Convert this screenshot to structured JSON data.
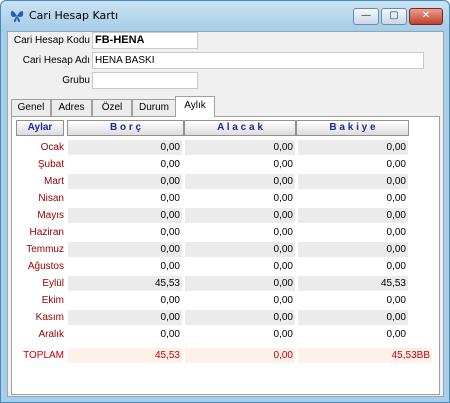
{
  "window": {
    "title": "Cari Hesap Kartı",
    "min_glyph": "—",
    "max_glyph": "▢",
    "close_glyph": "✕"
  },
  "form": {
    "code_label": "Cari Hesap Kodu",
    "code_value": "FB-HENA",
    "name_label": "Cari Hesap Adı",
    "name_value": "HENA BASKI",
    "group_label": "Grubu",
    "group_value": ""
  },
  "tabs": [
    "Genel",
    "Adres",
    "Özel",
    "Durum",
    "Aylık"
  ],
  "table": {
    "headers": [
      "Aylar",
      "B o r ç",
      "A l a c a k",
      "B a k i y e"
    ],
    "rows": [
      {
        "month": "Ocak",
        "borc": "0,00",
        "alacak": "0,00",
        "bakiye": "0,00"
      },
      {
        "month": "Şubat",
        "borc": "0,00",
        "alacak": "0,00",
        "bakiye": "0,00"
      },
      {
        "month": "Mart",
        "borc": "0,00",
        "alacak": "0,00",
        "bakiye": "0,00"
      },
      {
        "month": "Nisan",
        "borc": "0,00",
        "alacak": "0,00",
        "bakiye": "0,00"
      },
      {
        "month": "Mayıs",
        "borc": "0,00",
        "alacak": "0,00",
        "bakiye": "0,00"
      },
      {
        "month": "Haziran",
        "borc": "0,00",
        "alacak": "0,00",
        "bakiye": "0,00"
      },
      {
        "month": "Temmuz",
        "borc": "0,00",
        "alacak": "0,00",
        "bakiye": "0,00"
      },
      {
        "month": "Ağustos",
        "borc": "0,00",
        "alacak": "0,00",
        "bakiye": "0,00"
      },
      {
        "month": "Eylül",
        "borc": "45,53",
        "alacak": "0,00",
        "bakiye": "45,53"
      },
      {
        "month": "Ekim",
        "borc": "0,00",
        "alacak": "0,00",
        "bakiye": "0,00"
      },
      {
        "month": "Kasım",
        "borc": "0,00",
        "alacak": "0,00",
        "bakiye": "0,00"
      },
      {
        "month": "Aralık",
        "borc": "0,00",
        "alacak": "0,00",
        "bakiye": "0,00"
      }
    ],
    "total": {
      "month": "TOPLAM",
      "borc": "45,53",
      "alacak": "0,00",
      "bakiye": "45,53BB"
    }
  },
  "colors": {
    "month_label": "#a00000",
    "total": "#cc0000",
    "header_text": "#1a2a9a"
  },
  "icons": {
    "app": "butterfly-icon"
  }
}
